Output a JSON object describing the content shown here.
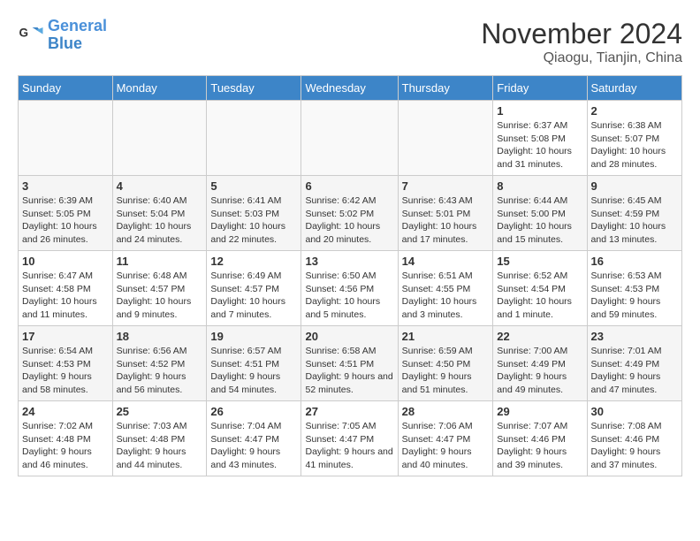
{
  "header": {
    "logo_line1": "General",
    "logo_line2": "Blue",
    "month": "November 2024",
    "location": "Qiaogu, Tianjin, China"
  },
  "days_of_week": [
    "Sunday",
    "Monday",
    "Tuesday",
    "Wednesday",
    "Thursday",
    "Friday",
    "Saturday"
  ],
  "weeks": [
    [
      {
        "day": "",
        "info": ""
      },
      {
        "day": "",
        "info": ""
      },
      {
        "day": "",
        "info": ""
      },
      {
        "day": "",
        "info": ""
      },
      {
        "day": "",
        "info": ""
      },
      {
        "day": "1",
        "info": "Sunrise: 6:37 AM\nSunset: 5:08 PM\nDaylight: 10 hours and 31 minutes."
      },
      {
        "day": "2",
        "info": "Sunrise: 6:38 AM\nSunset: 5:07 PM\nDaylight: 10 hours and 28 minutes."
      }
    ],
    [
      {
        "day": "3",
        "info": "Sunrise: 6:39 AM\nSunset: 5:05 PM\nDaylight: 10 hours and 26 minutes."
      },
      {
        "day": "4",
        "info": "Sunrise: 6:40 AM\nSunset: 5:04 PM\nDaylight: 10 hours and 24 minutes."
      },
      {
        "day": "5",
        "info": "Sunrise: 6:41 AM\nSunset: 5:03 PM\nDaylight: 10 hours and 22 minutes."
      },
      {
        "day": "6",
        "info": "Sunrise: 6:42 AM\nSunset: 5:02 PM\nDaylight: 10 hours and 20 minutes."
      },
      {
        "day": "7",
        "info": "Sunrise: 6:43 AM\nSunset: 5:01 PM\nDaylight: 10 hours and 17 minutes."
      },
      {
        "day": "8",
        "info": "Sunrise: 6:44 AM\nSunset: 5:00 PM\nDaylight: 10 hours and 15 minutes."
      },
      {
        "day": "9",
        "info": "Sunrise: 6:45 AM\nSunset: 4:59 PM\nDaylight: 10 hours and 13 minutes."
      }
    ],
    [
      {
        "day": "10",
        "info": "Sunrise: 6:47 AM\nSunset: 4:58 PM\nDaylight: 10 hours and 11 minutes."
      },
      {
        "day": "11",
        "info": "Sunrise: 6:48 AM\nSunset: 4:57 PM\nDaylight: 10 hours and 9 minutes."
      },
      {
        "day": "12",
        "info": "Sunrise: 6:49 AM\nSunset: 4:57 PM\nDaylight: 10 hours and 7 minutes."
      },
      {
        "day": "13",
        "info": "Sunrise: 6:50 AM\nSunset: 4:56 PM\nDaylight: 10 hours and 5 minutes."
      },
      {
        "day": "14",
        "info": "Sunrise: 6:51 AM\nSunset: 4:55 PM\nDaylight: 10 hours and 3 minutes."
      },
      {
        "day": "15",
        "info": "Sunrise: 6:52 AM\nSunset: 4:54 PM\nDaylight: 10 hours and 1 minute."
      },
      {
        "day": "16",
        "info": "Sunrise: 6:53 AM\nSunset: 4:53 PM\nDaylight: 9 hours and 59 minutes."
      }
    ],
    [
      {
        "day": "17",
        "info": "Sunrise: 6:54 AM\nSunset: 4:53 PM\nDaylight: 9 hours and 58 minutes."
      },
      {
        "day": "18",
        "info": "Sunrise: 6:56 AM\nSunset: 4:52 PM\nDaylight: 9 hours and 56 minutes."
      },
      {
        "day": "19",
        "info": "Sunrise: 6:57 AM\nSunset: 4:51 PM\nDaylight: 9 hours and 54 minutes."
      },
      {
        "day": "20",
        "info": "Sunrise: 6:58 AM\nSunset: 4:51 PM\nDaylight: 9 hours and 52 minutes."
      },
      {
        "day": "21",
        "info": "Sunrise: 6:59 AM\nSunset: 4:50 PM\nDaylight: 9 hours and 51 minutes."
      },
      {
        "day": "22",
        "info": "Sunrise: 7:00 AM\nSunset: 4:49 PM\nDaylight: 9 hours and 49 minutes."
      },
      {
        "day": "23",
        "info": "Sunrise: 7:01 AM\nSunset: 4:49 PM\nDaylight: 9 hours and 47 minutes."
      }
    ],
    [
      {
        "day": "24",
        "info": "Sunrise: 7:02 AM\nSunset: 4:48 PM\nDaylight: 9 hours and 46 minutes."
      },
      {
        "day": "25",
        "info": "Sunrise: 7:03 AM\nSunset: 4:48 PM\nDaylight: 9 hours and 44 minutes."
      },
      {
        "day": "26",
        "info": "Sunrise: 7:04 AM\nSunset: 4:47 PM\nDaylight: 9 hours and 43 minutes."
      },
      {
        "day": "27",
        "info": "Sunrise: 7:05 AM\nSunset: 4:47 PM\nDaylight: 9 hours and 41 minutes."
      },
      {
        "day": "28",
        "info": "Sunrise: 7:06 AM\nSunset: 4:47 PM\nDaylight: 9 hours and 40 minutes."
      },
      {
        "day": "29",
        "info": "Sunrise: 7:07 AM\nSunset: 4:46 PM\nDaylight: 9 hours and 39 minutes."
      },
      {
        "day": "30",
        "info": "Sunrise: 7:08 AM\nSunset: 4:46 PM\nDaylight: 9 hours and 37 minutes."
      }
    ]
  ]
}
